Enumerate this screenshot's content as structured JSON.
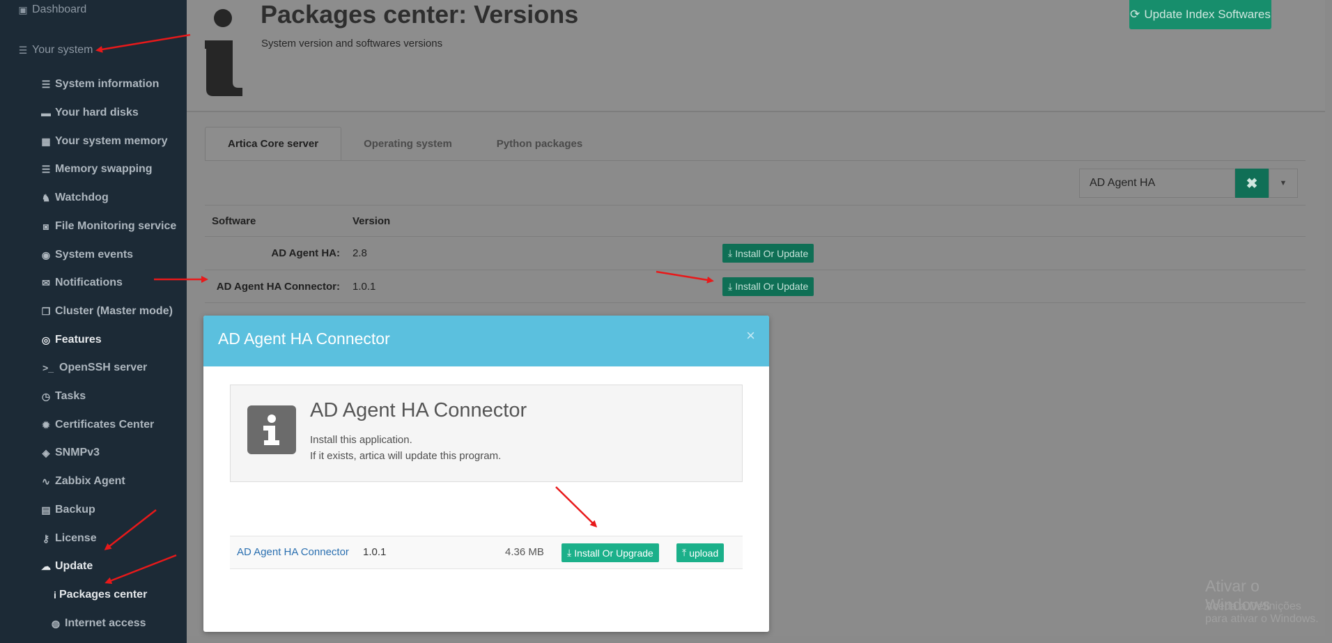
{
  "sidebar": {
    "items": [
      {
        "label": "Dashboard",
        "icon": "dashboard-icon"
      },
      {
        "label": "Your system",
        "icon": "server-icon"
      },
      {
        "label": "System information",
        "icon": "server-icon"
      },
      {
        "label": "Your hard disks",
        "icon": "hdd-icon"
      },
      {
        "label": "Your system memory",
        "icon": "memory-icon"
      },
      {
        "label": "Memory swapping",
        "icon": "server-icon"
      },
      {
        "label": "Watchdog",
        "icon": "dog-icon"
      },
      {
        "label": "File Monitoring service",
        "icon": "camera-icon"
      },
      {
        "label": "System events",
        "icon": "eye-icon"
      },
      {
        "label": "Notifications",
        "icon": "envelope-icon"
      },
      {
        "label": "Cluster (Master mode)",
        "icon": "copy-icon"
      },
      {
        "label": "Features",
        "icon": "target-icon"
      },
      {
        "label": "OpenSSH server",
        "icon": "terminal-icon"
      },
      {
        "label": "Tasks",
        "icon": "clock-icon"
      },
      {
        "label": "Certificates Center",
        "icon": "certificate-icon"
      },
      {
        "label": "SNMPv3",
        "icon": "comment-icon"
      },
      {
        "label": "Zabbix Agent",
        "icon": "heartbeat-icon"
      },
      {
        "label": "Backup",
        "icon": "archive-icon"
      },
      {
        "label": "License",
        "icon": "key-icon"
      },
      {
        "label": "Update",
        "icon": "cloud-download-icon"
      },
      {
        "label": "Packages center",
        "icon": "info-icon"
      },
      {
        "label": "Internet access",
        "icon": "globe-icon"
      }
    ]
  },
  "header": {
    "title": "Packages center: Versions",
    "subtitle": "System version and softwares versions",
    "update_button": "Update Index Softwares"
  },
  "tabs": [
    {
      "label": "Artica Core server"
    },
    {
      "label": "Operating system"
    },
    {
      "label": "Python packages"
    }
  ],
  "search": {
    "value": "AD Agent HA"
  },
  "table": {
    "columns": [
      "Software",
      "Version"
    ],
    "rows": [
      {
        "software": "AD Agent HA:",
        "version": "2.8",
        "action": "Install Or Update"
      },
      {
        "software": "AD Agent HA Connector:",
        "version": "1.0.1",
        "action": "Install Or Update"
      }
    ]
  },
  "modal": {
    "title": "AD Agent HA Connector",
    "close": "×",
    "info_title": "AD Agent HA Connector",
    "info_line1": "Install this application.",
    "info_line2": "If it exists, artica will update this program.",
    "package": {
      "name": "AD Agent HA Connector",
      "version": "1.0.1",
      "size": "4.36 MB",
      "install_button": "Install Or Upgrade",
      "upload_button": "upload"
    }
  },
  "watermark": {
    "title": "Ativar o Windows",
    "subtitle": "Aceda a Definições para ativar o Windows."
  },
  "colors": {
    "sidebar_bg": "#1c2a36",
    "accent_green": "#1bb08a",
    "modal_header": "#5bc0de",
    "annotation_arrow": "#e8191a"
  }
}
